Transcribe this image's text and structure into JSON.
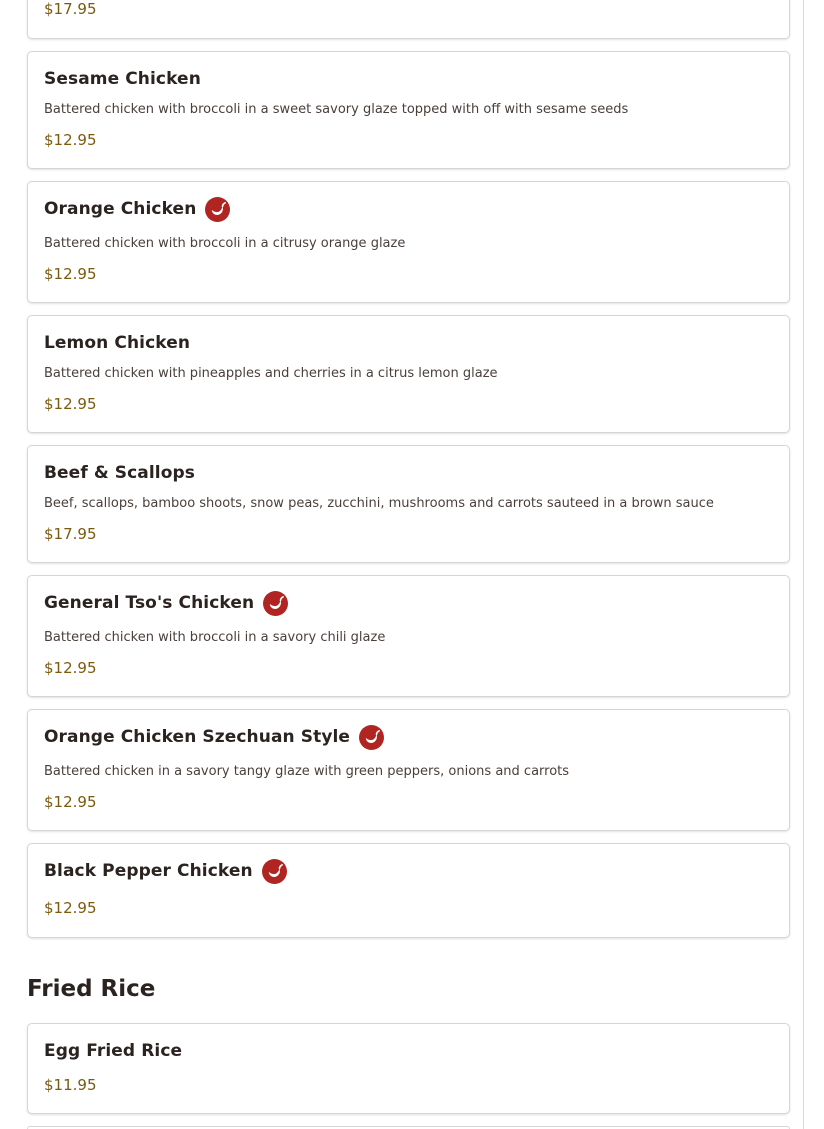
{
  "icons": {
    "spicy": "chili-pepper-icon",
    "spicy_color": "#b02421"
  },
  "colors": {
    "price": "#7a5a0e",
    "text": "#2b2320",
    "border": "#d6d6d6"
  },
  "menu": {
    "partial_item": {
      "price": "$17.95"
    },
    "items": [
      {
        "name": "Sesame Chicken",
        "spicy": false,
        "description": "Battered chicken with broccoli in a sweet savory glaze topped with off with sesame seeds",
        "price": "$12.95"
      },
      {
        "name": "Orange Chicken",
        "spicy": true,
        "description": "Battered chicken with broccoli in a citrusy orange glaze",
        "price": "$12.95"
      },
      {
        "name": "Lemon Chicken",
        "spicy": false,
        "description": "Battered chicken with pineapples and cherries in a citrus lemon glaze",
        "price": "$12.95"
      },
      {
        "name": "Beef & Scallops",
        "spicy": false,
        "description": "Beef, scallops, bamboo shoots, snow peas, zucchini, mushrooms and carrots sauteed in a brown sauce",
        "price": "$17.95"
      },
      {
        "name": "General Tso's Chicken",
        "spicy": true,
        "description": "Battered chicken with broccoli in a savory chili glaze",
        "price": "$12.95"
      },
      {
        "name": "Orange Chicken Szechuan Style",
        "spicy": true,
        "description": "Battered chicken in a savory tangy glaze with green peppers, onions and carrots",
        "price": "$12.95"
      },
      {
        "name": "Black Pepper Chicken",
        "spicy": true,
        "price": "$12.95"
      }
    ],
    "sections": [
      {
        "title": "Fried Rice",
        "items": [
          {
            "name": "Egg Fried Rice",
            "price": "$11.95"
          }
        ]
      }
    ]
  }
}
